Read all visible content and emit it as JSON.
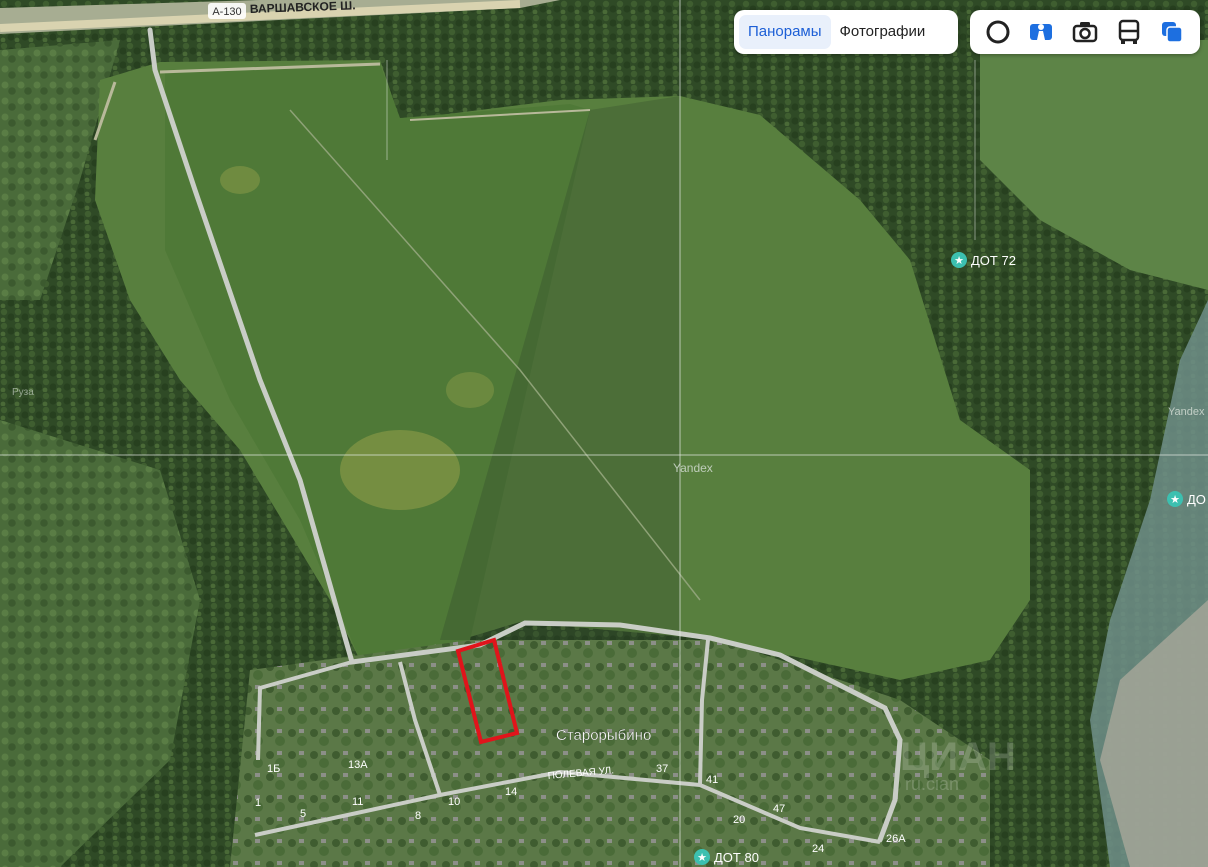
{
  "map": {
    "highway_shield": "А-130",
    "highway_name": "ВАРШАВСКОЕ Ш.",
    "village_name": "Старорыбино",
    "street_name": "ПОЛЕВАЯ УЛ.",
    "watermark": "Yandex",
    "watermark_right": "Yandex",
    "watermark_left": "Руза",
    "cian_watermark": "ЦИАН",
    "cian_watermark_sub": "ru.cian",
    "pois": [
      {
        "label": "ДОТ 72"
      },
      {
        "label": "ДО"
      },
      {
        "label": "ДОТ 80"
      }
    ],
    "house_numbers": [
      "1Б",
      "13А",
      "1",
      "11",
      "5",
      "10",
      "8",
      "14",
      "37",
      "41",
      "47",
      "20",
      "26А",
      "24"
    ],
    "plot_outline_color": "#e0141b",
    "road_color": "#c9cdc6"
  },
  "layers": {
    "panoramas_label": "Панорамы",
    "photos_label": "Фотографии"
  },
  "controls": [
    {
      "icon": "traffic-ring-icon"
    },
    {
      "icon": "panorama-person-icon"
    },
    {
      "icon": "camera-icon"
    },
    {
      "icon": "bus-icon"
    },
    {
      "icon": "layers-icon"
    }
  ]
}
